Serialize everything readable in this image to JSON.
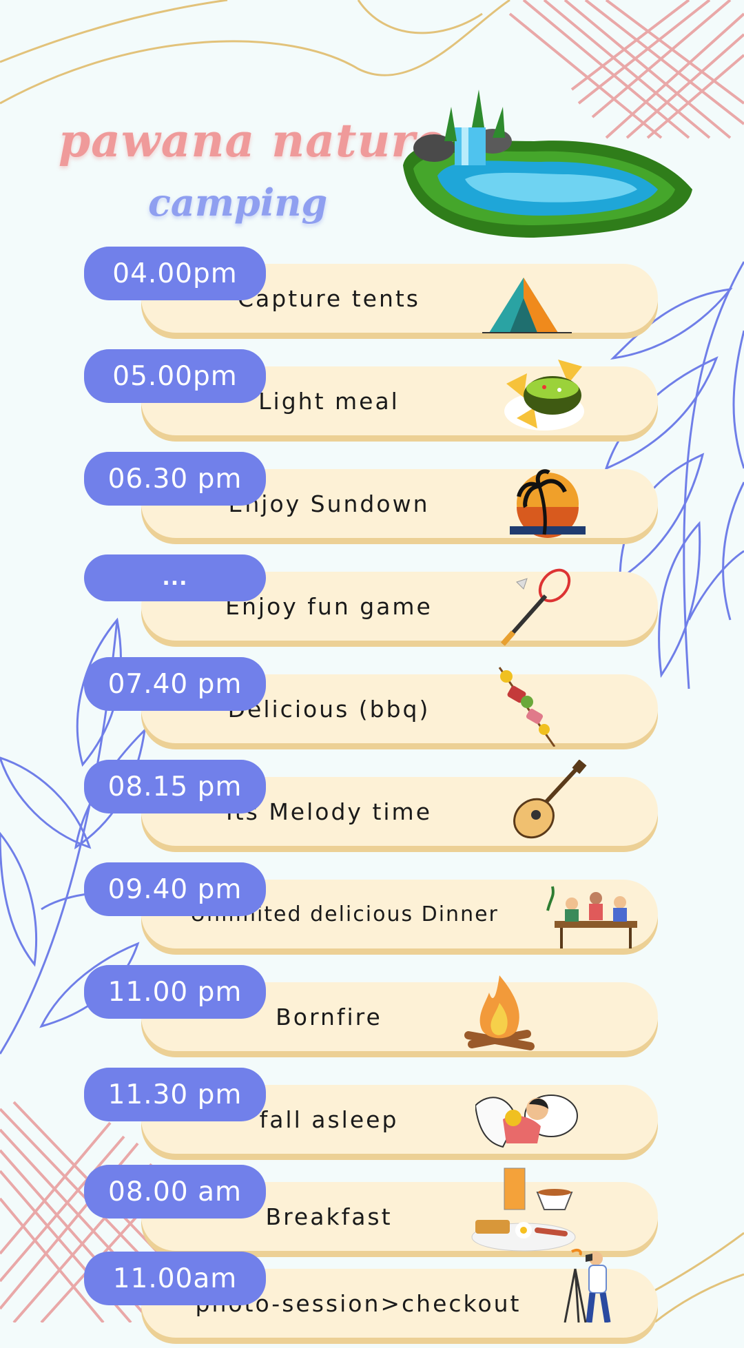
{
  "title": {
    "line1": "pawana nature",
    "line2": "camping"
  },
  "colors": {
    "pill": "#7180ea",
    "bar": "#fdf1d6",
    "bar_shadow": "#ecd095",
    "title1": "#ef9a9a",
    "title2": "#8f9ff0",
    "leaves": "#6f7ee8",
    "hatch": "#e89a9a"
  },
  "schedule": [
    {
      "time": "04.00pm",
      "activity": "Capture tents",
      "icon": "tent-icon"
    },
    {
      "time": "05.00pm",
      "activity": "Light meal",
      "icon": "nachos-icon"
    },
    {
      "time": "06.30 pm",
      "activity": "Enjoy Sundown",
      "icon": "sunset-palm-icon"
    },
    {
      "time": "...",
      "activity": "Enjoy fun game",
      "icon": "badminton-icon"
    },
    {
      "time": "07.40 pm",
      "activity": "Delicious (bbq)",
      "icon": "skewer-icon"
    },
    {
      "time": "08.15 pm",
      "activity": "Its Melody time",
      "icon": "guitar-icon"
    },
    {
      "time": "09.40 pm",
      "activity": "Unlimited delicious Dinner",
      "icon": "dinner-table-icon"
    },
    {
      "time": "11.00 pm",
      "activity": "Bornfire",
      "icon": "bonfire-icon"
    },
    {
      "time": "11.30 pm",
      "activity": "fall asleep",
      "icon": "sleeping-icon"
    },
    {
      "time": "08.00 am",
      "activity": "Breakfast",
      "icon": "breakfast-icon"
    },
    {
      "time": "11.00am",
      "activity": "photo-session>checkout",
      "icon": "photographer-icon"
    }
  ]
}
